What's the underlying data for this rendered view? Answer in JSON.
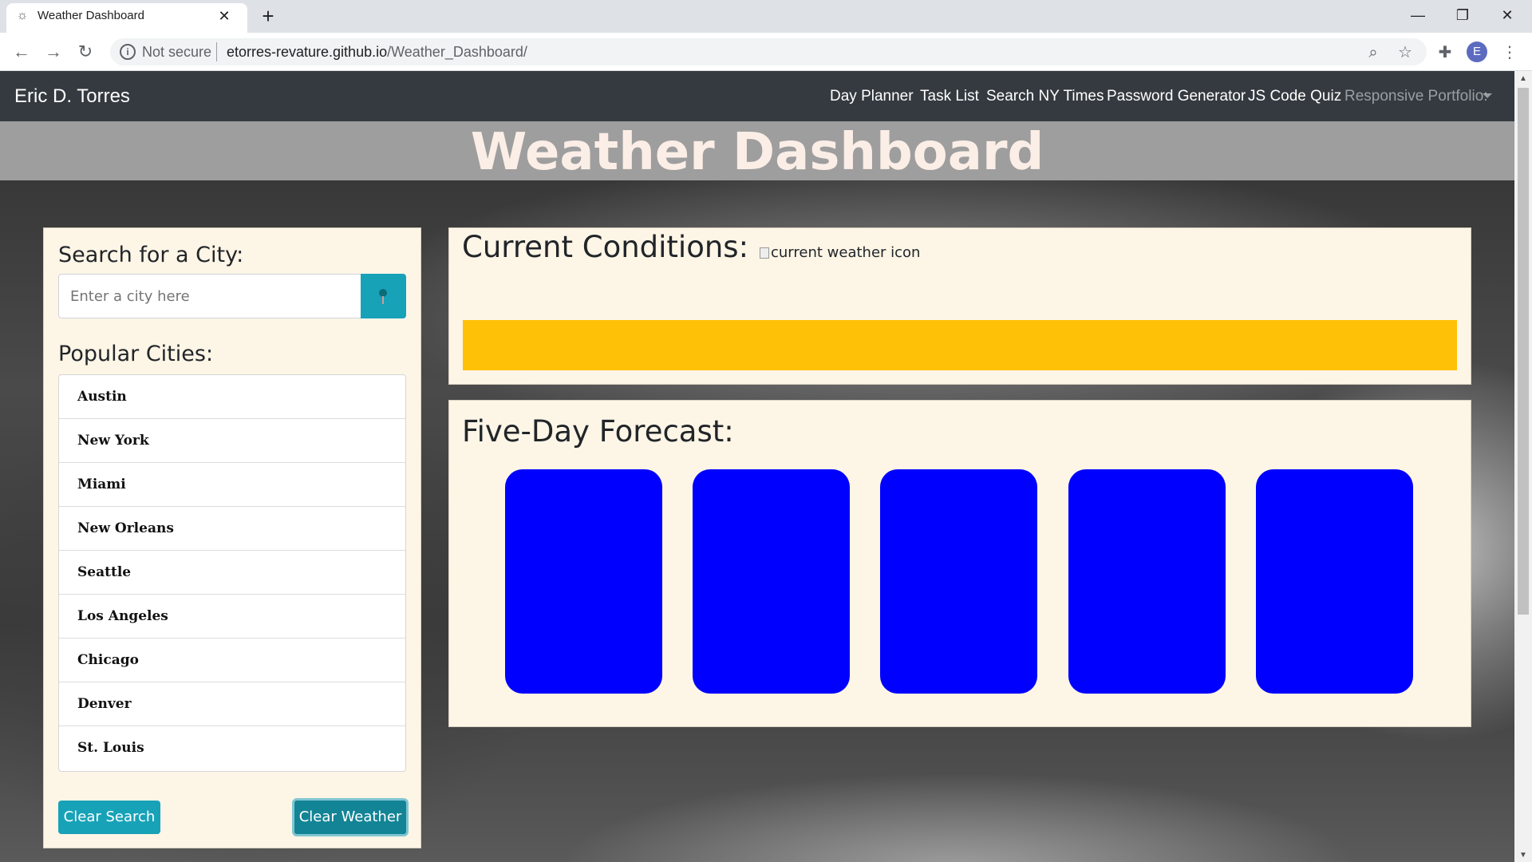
{
  "browser": {
    "tab_title": "Weather Dashboard",
    "new_tab_label": "+",
    "security_label": "Not secure",
    "url_host": "etorres-revature.github.io",
    "url_path": "/Weather_Dashboard/",
    "profile_initial": "E"
  },
  "navbar": {
    "brand": "Eric D. Torres",
    "links": [
      "Day Planner",
      "Task List",
      "Search NY Times",
      "Password Generator",
      "JS Code Quiz"
    ],
    "dropdown_label": "Responsive Portfolio:"
  },
  "page": {
    "title": "Weather Dashboard"
  },
  "search": {
    "heading": "Search for a City:",
    "placeholder": "Enter a city here",
    "popular_heading": "Popular Cities:",
    "cities": [
      "Austin",
      "New York",
      "Miami",
      "New Orleans",
      "Seattle",
      "Los Angeles",
      "Chicago",
      "Denver",
      "St. Louis"
    ],
    "clear_search_label": "Clear Search",
    "clear_weather_label": "Clear Weather"
  },
  "current": {
    "heading": "Current Conditions:",
    "icon_alt": "current weather icon",
    "bar_color": "#ffc107"
  },
  "forecast": {
    "heading": "Five-Day Forecast:",
    "card_color": "#0000ff",
    "card_count": 5
  }
}
